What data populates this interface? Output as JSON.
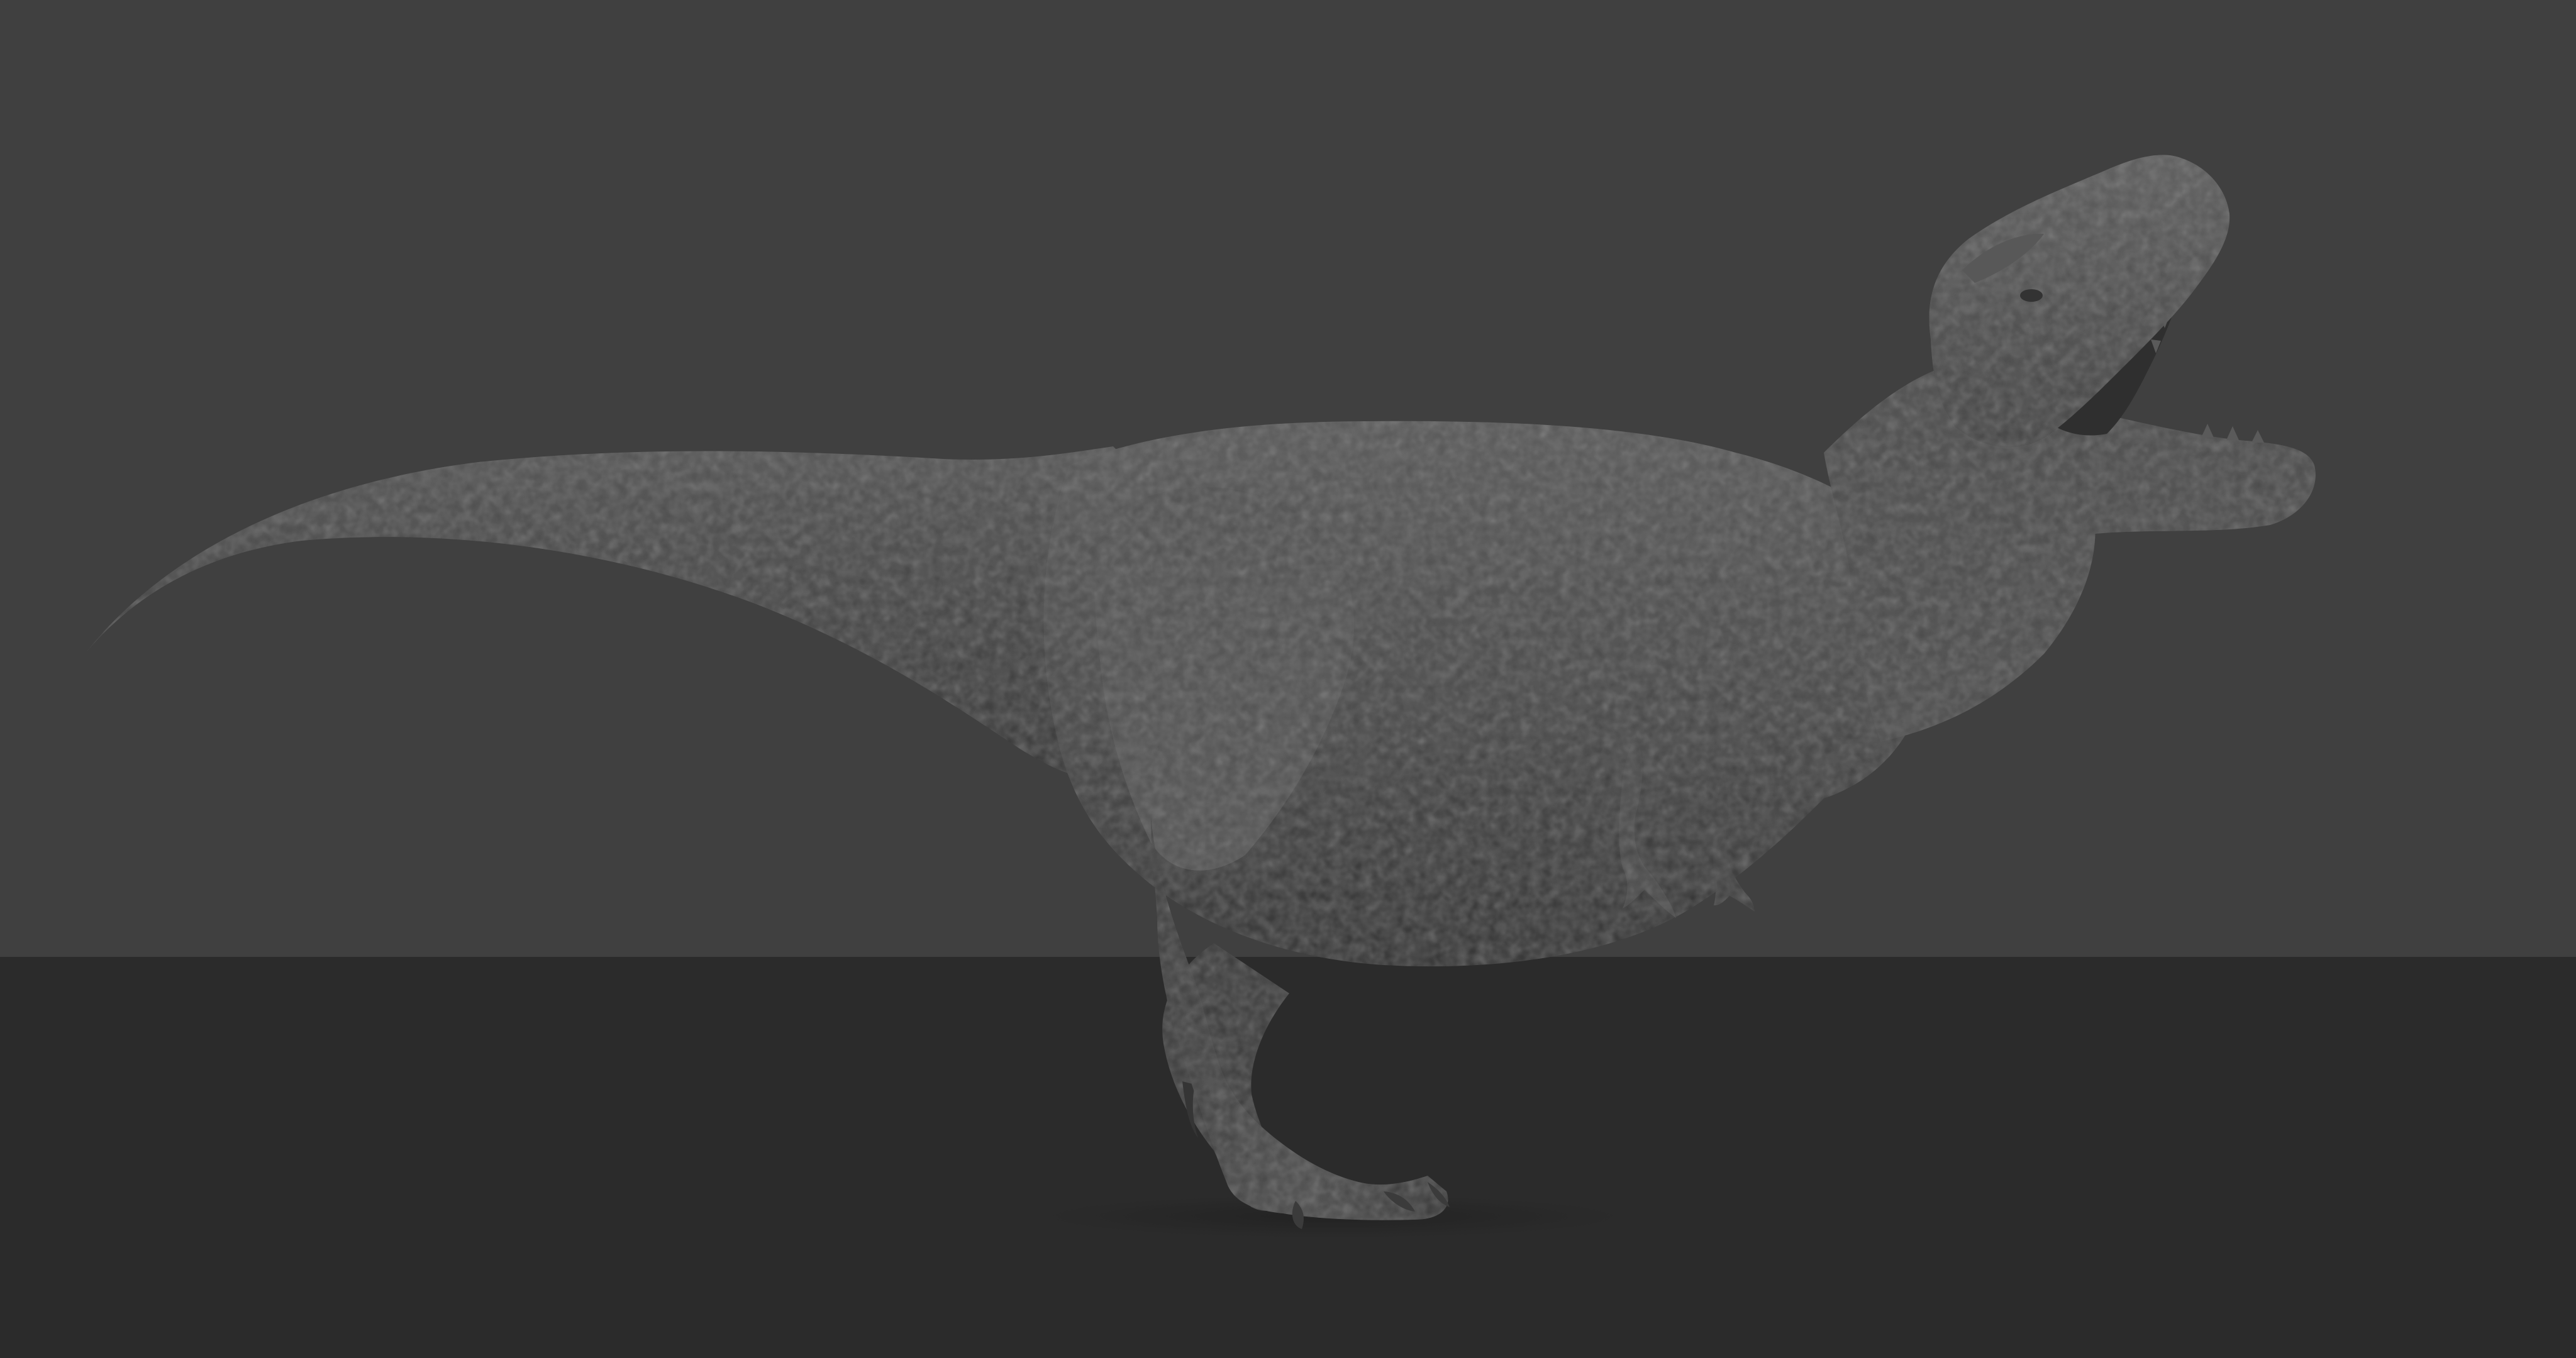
{
  "scene": {
    "wall_color": "#404040",
    "ground_color": "#2b2b2b",
    "subject": "t-rex-sculpt",
    "model_base_color": "#4a4a4a",
    "model_light_color": "#5c5c5c",
    "model_shadow_color": "#333333"
  }
}
